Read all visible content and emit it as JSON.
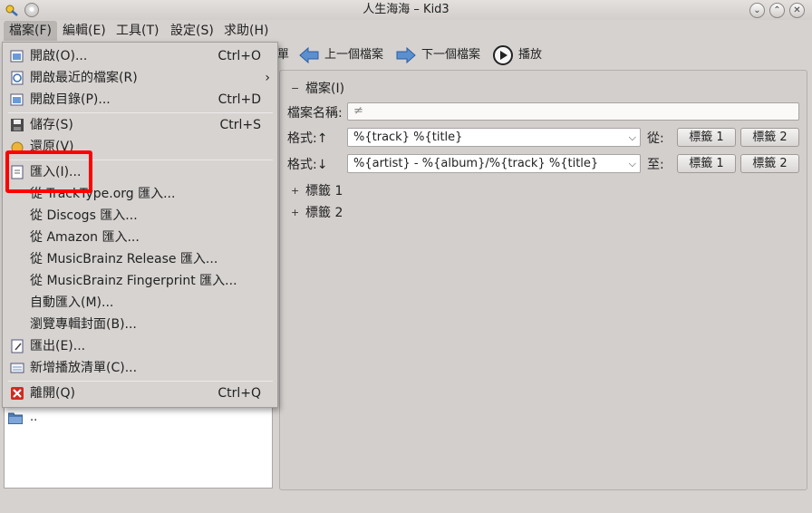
{
  "window": {
    "title": "人生海海 – Kid3"
  },
  "menubar": {
    "items": [
      {
        "label": "檔案(F)"
      },
      {
        "label": "編輯(E)"
      },
      {
        "label": "工具(T)"
      },
      {
        "label": "設定(S)"
      },
      {
        "label": "求助(H)"
      }
    ]
  },
  "toolbar": {
    "partial_label": "單",
    "prev_label": "上一個檔案",
    "next_label": "下一個檔案",
    "play_label": "播放"
  },
  "file_menu": {
    "items": [
      {
        "label": "開啟(O)...",
        "shortcut": "Ctrl+O",
        "icon": "open-file-icon"
      },
      {
        "label": "開啟最近的檔案(R)",
        "shortcut": "",
        "icon": "recent-files-icon"
      },
      {
        "label": "開啟目錄(P)...",
        "shortcut": "Ctrl+D",
        "icon": "open-folder-icon"
      },
      {
        "label": "儲存(S)",
        "shortcut": "Ctrl+S",
        "icon": "save-icon"
      },
      {
        "label": "還原(V)",
        "shortcut": "",
        "icon": "revert-icon"
      },
      {
        "label": "匯入(I)...",
        "shortcut": "",
        "icon": "import-icon"
      },
      {
        "label": "從 TrackType.org 匯入...",
        "shortcut": ""
      },
      {
        "label": "從 Discogs 匯入...",
        "shortcut": ""
      },
      {
        "label": "從 Amazon 匯入...",
        "shortcut": ""
      },
      {
        "label": "從 MusicBrainz Release 匯入...",
        "shortcut": ""
      },
      {
        "label": "從 MusicBrainz Fingerprint 匯入...",
        "shortcut": ""
      },
      {
        "label": "自動匯入(M)...",
        "shortcut": ""
      },
      {
        "label": "瀏覽專輯封面(B)...",
        "shortcut": ""
      },
      {
        "label": "匯出(E)...",
        "shortcut": "",
        "icon": "export-icon"
      },
      {
        "label": "新增播放清單(C)...",
        "shortcut": "",
        "icon": "playlist-icon"
      },
      {
        "label": "離開(Q)",
        "shortcut": "Ctrl+Q",
        "icon": "quit-icon"
      }
    ]
  },
  "dir_list": {
    "parent_entry": ".."
  },
  "file_panel": {
    "section_label": "檔案(I)",
    "filename_label": "檔案名稱:",
    "filename_value": "≠",
    "format_up_label": "格式:↑",
    "format_up_value": "%{track} %{title}",
    "from_label": "從:",
    "format_down_label": "格式:↓",
    "format_down_value": "%{artist} - %{album}/%{track} %{title}",
    "to_label": "至:",
    "tag1_button": "標籤 1",
    "tag2_button": "標籤 2",
    "tag1_section": "標籤 1",
    "tag2_section": "標籤 2"
  }
}
